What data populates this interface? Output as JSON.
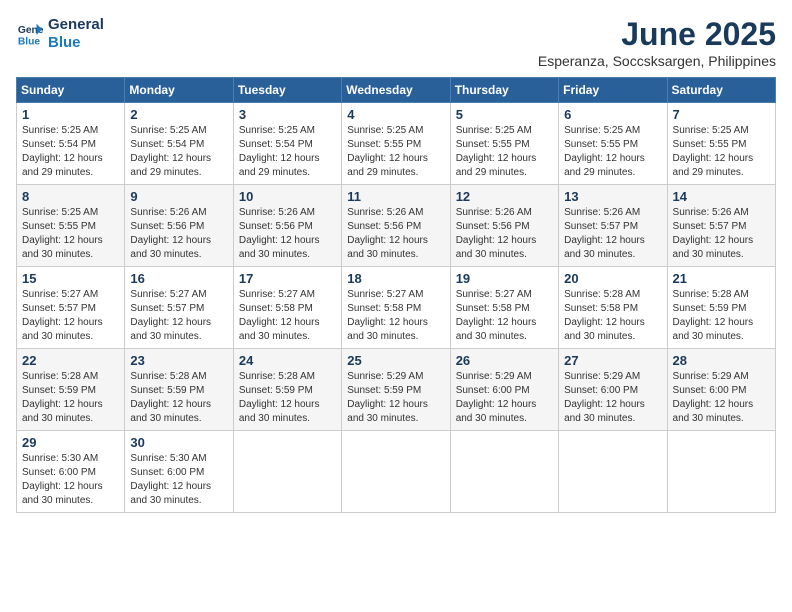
{
  "logo": {
    "line1": "General",
    "line2": "Blue"
  },
  "title": "June 2025",
  "subtitle": "Esperanza, Soccsksargen, Philippines",
  "weekdays": [
    "Sunday",
    "Monday",
    "Tuesday",
    "Wednesday",
    "Thursday",
    "Friday",
    "Saturday"
  ],
  "weeks": [
    [
      {
        "day": "1",
        "sunrise": "5:25 AM",
        "sunset": "5:54 PM",
        "daylight": "12 hours and 29 minutes."
      },
      {
        "day": "2",
        "sunrise": "5:25 AM",
        "sunset": "5:54 PM",
        "daylight": "12 hours and 29 minutes."
      },
      {
        "day": "3",
        "sunrise": "5:25 AM",
        "sunset": "5:54 PM",
        "daylight": "12 hours and 29 minutes."
      },
      {
        "day": "4",
        "sunrise": "5:25 AM",
        "sunset": "5:55 PM",
        "daylight": "12 hours and 29 minutes."
      },
      {
        "day": "5",
        "sunrise": "5:25 AM",
        "sunset": "5:55 PM",
        "daylight": "12 hours and 29 minutes."
      },
      {
        "day": "6",
        "sunrise": "5:25 AM",
        "sunset": "5:55 PM",
        "daylight": "12 hours and 29 minutes."
      },
      {
        "day": "7",
        "sunrise": "5:25 AM",
        "sunset": "5:55 PM",
        "daylight": "12 hours and 29 minutes."
      }
    ],
    [
      {
        "day": "8",
        "sunrise": "5:25 AM",
        "sunset": "5:55 PM",
        "daylight": "12 hours and 30 minutes."
      },
      {
        "day": "9",
        "sunrise": "5:26 AM",
        "sunset": "5:56 PM",
        "daylight": "12 hours and 30 minutes."
      },
      {
        "day": "10",
        "sunrise": "5:26 AM",
        "sunset": "5:56 PM",
        "daylight": "12 hours and 30 minutes."
      },
      {
        "day": "11",
        "sunrise": "5:26 AM",
        "sunset": "5:56 PM",
        "daylight": "12 hours and 30 minutes."
      },
      {
        "day": "12",
        "sunrise": "5:26 AM",
        "sunset": "5:56 PM",
        "daylight": "12 hours and 30 minutes."
      },
      {
        "day": "13",
        "sunrise": "5:26 AM",
        "sunset": "5:57 PM",
        "daylight": "12 hours and 30 minutes."
      },
      {
        "day": "14",
        "sunrise": "5:26 AM",
        "sunset": "5:57 PM",
        "daylight": "12 hours and 30 minutes."
      }
    ],
    [
      {
        "day": "15",
        "sunrise": "5:27 AM",
        "sunset": "5:57 PM",
        "daylight": "12 hours and 30 minutes."
      },
      {
        "day": "16",
        "sunrise": "5:27 AM",
        "sunset": "5:57 PM",
        "daylight": "12 hours and 30 minutes."
      },
      {
        "day": "17",
        "sunrise": "5:27 AM",
        "sunset": "5:58 PM",
        "daylight": "12 hours and 30 minutes."
      },
      {
        "day": "18",
        "sunrise": "5:27 AM",
        "sunset": "5:58 PM",
        "daylight": "12 hours and 30 minutes."
      },
      {
        "day": "19",
        "sunrise": "5:27 AM",
        "sunset": "5:58 PM",
        "daylight": "12 hours and 30 minutes."
      },
      {
        "day": "20",
        "sunrise": "5:28 AM",
        "sunset": "5:58 PM",
        "daylight": "12 hours and 30 minutes."
      },
      {
        "day": "21",
        "sunrise": "5:28 AM",
        "sunset": "5:59 PM",
        "daylight": "12 hours and 30 minutes."
      }
    ],
    [
      {
        "day": "22",
        "sunrise": "5:28 AM",
        "sunset": "5:59 PM",
        "daylight": "12 hours and 30 minutes."
      },
      {
        "day": "23",
        "sunrise": "5:28 AM",
        "sunset": "5:59 PM",
        "daylight": "12 hours and 30 minutes."
      },
      {
        "day": "24",
        "sunrise": "5:28 AM",
        "sunset": "5:59 PM",
        "daylight": "12 hours and 30 minutes."
      },
      {
        "day": "25",
        "sunrise": "5:29 AM",
        "sunset": "5:59 PM",
        "daylight": "12 hours and 30 minutes."
      },
      {
        "day": "26",
        "sunrise": "5:29 AM",
        "sunset": "6:00 PM",
        "daylight": "12 hours and 30 minutes."
      },
      {
        "day": "27",
        "sunrise": "5:29 AM",
        "sunset": "6:00 PM",
        "daylight": "12 hours and 30 minutes."
      },
      {
        "day": "28",
        "sunrise": "5:29 AM",
        "sunset": "6:00 PM",
        "daylight": "12 hours and 30 minutes."
      }
    ],
    [
      {
        "day": "29",
        "sunrise": "5:30 AM",
        "sunset": "6:00 PM",
        "daylight": "12 hours and 30 minutes."
      },
      {
        "day": "30",
        "sunrise": "5:30 AM",
        "sunset": "6:00 PM",
        "daylight": "12 hours and 30 minutes."
      },
      null,
      null,
      null,
      null,
      null
    ]
  ],
  "labels": {
    "sunrise": "Sunrise:",
    "sunset": "Sunset:",
    "daylight": "Daylight:"
  }
}
